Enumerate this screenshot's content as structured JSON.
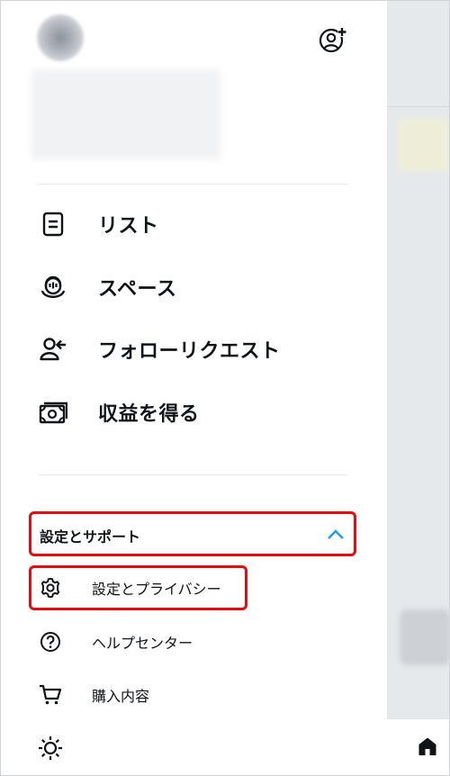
{
  "header": {
    "add_account_icon": "add-account-icon",
    "avatar": "blurred-avatar"
  },
  "menu": [
    {
      "label": "リスト",
      "icon": "list-icon"
    },
    {
      "label": "スペース",
      "icon": "spaces-icon"
    },
    {
      "label": "フォローリクエスト",
      "icon": "follow-request-icon"
    },
    {
      "label": "収益を得る",
      "icon": "monetization-icon"
    }
  ],
  "settings_section": {
    "label": "設定とサポート",
    "expanded": true,
    "accent_color": "#1d9bf0",
    "highlight_color": "#e40c0c",
    "items": [
      {
        "label": "設定とプライバシー",
        "icon": "gear-icon",
        "highlighted": true
      },
      {
        "label": "ヘルプセンター",
        "icon": "help-icon",
        "highlighted": false
      },
      {
        "label": "購入内容",
        "icon": "cart-icon",
        "highlighted": false
      }
    ],
    "display_icon": "brightness-icon"
  },
  "bottom_bar": {
    "home_icon": "home-icon"
  }
}
